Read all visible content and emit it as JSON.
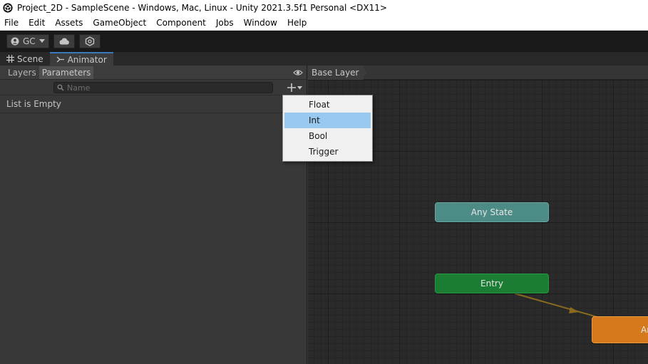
{
  "window": {
    "title": "Project_2D - SampleScene - Windows, Mac, Linux - Unity 2021.3.5f1 Personal <DX11>"
  },
  "menu": [
    "File",
    "Edit",
    "Assets",
    "GameObject",
    "Component",
    "Jobs",
    "Window",
    "Help"
  ],
  "toolbar": {
    "account_label": "GC"
  },
  "tabs": [
    {
      "label": "Scene",
      "icon": "grid-icon"
    },
    {
      "label": "Animator",
      "icon": "animator-icon"
    }
  ],
  "left_panel": {
    "segments": [
      "Layers",
      "Parameters"
    ],
    "active_segment": "Parameters",
    "search": {
      "placeholder": "Name",
      "value": ""
    },
    "empty_text": "List is Empty"
  },
  "dropdown": {
    "items": [
      "Float",
      "Int",
      "Bool",
      "Trigger"
    ],
    "selected": "Int"
  },
  "graph": {
    "breadcrumb": "Base Layer",
    "nodes": {
      "any_state": "Any State",
      "entry": "Entry",
      "default_partial": "An"
    },
    "colors": {
      "any_state": "#4d8c86",
      "entry": "#1b7c33",
      "default": "#d47a1c",
      "transition": "#8a6a1e"
    }
  },
  "colors": {
    "tab_accent": "#3a79bb",
    "dropdown_highlight": "#99c9ef"
  }
}
